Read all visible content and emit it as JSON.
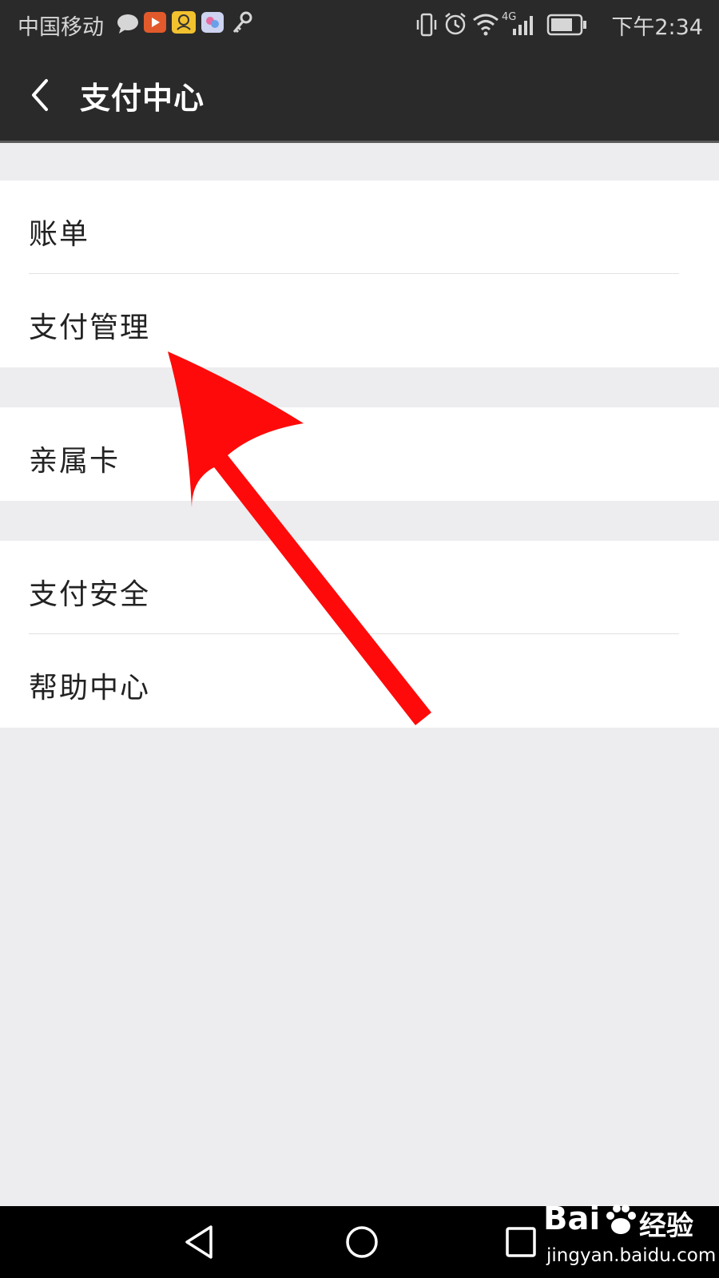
{
  "status_bar": {
    "carrier": "中国移动",
    "notification_icons": [
      "chat-bubble-icon",
      "video-app-icon",
      "qq-icon",
      "app-icon",
      "key-icon"
    ],
    "network": "4G",
    "time": "下午2:34"
  },
  "header": {
    "title": "支付中心",
    "back_icon": "chevron-left-icon"
  },
  "menu": {
    "group1": [
      "账单",
      "支付管理"
    ],
    "group2": [
      "亲属卡"
    ],
    "group3": [
      "支付安全",
      "帮助中心"
    ]
  },
  "nav": {
    "back": "triangle-back-icon",
    "home": "circle-home-icon",
    "recents": "square-recents-icon"
  },
  "watermark": {
    "brand": "Bai",
    "brand_suffix": "经验",
    "url": "jingyan.baidu.com"
  },
  "colors": {
    "header_bg": "#2b2a2b",
    "page_bg": "#edecef",
    "arrow": "#ff0a0a"
  }
}
